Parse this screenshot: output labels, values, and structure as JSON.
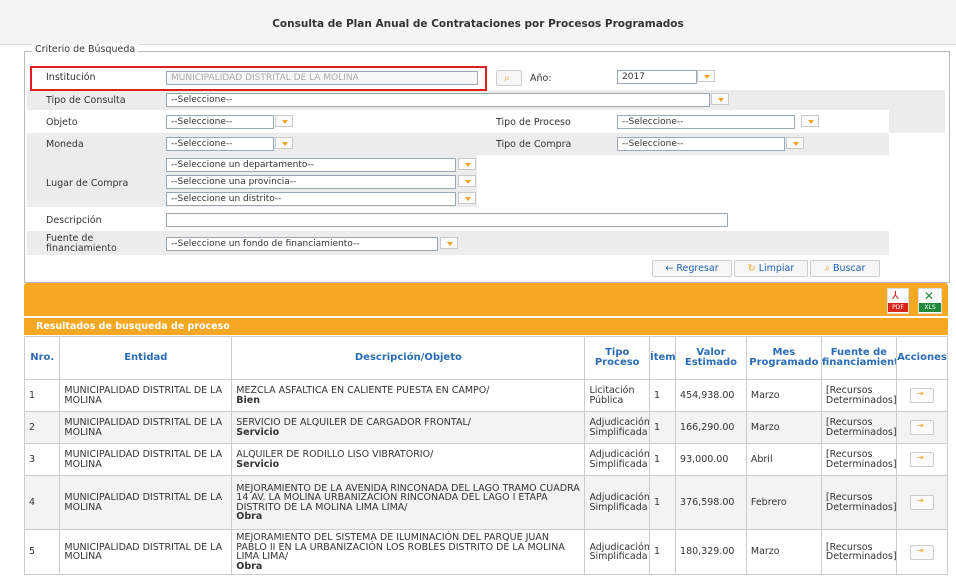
{
  "page_title": "Consulta de Plan Anual de Contrataciones por Procesos Programados",
  "criteria": {
    "legend": "Criterio de Búsqueda",
    "institucion_label": "Institución",
    "institucion_value": "MUNICIPALIDAD DISTRITAL DE LA MOLINA",
    "anio_label": "Año:",
    "anio_value": "2017",
    "tipo_consulta_label": "Tipo de Consulta",
    "tipo_consulta_value": "--Seleccione--",
    "objeto_label": "Objeto",
    "objeto_value": "--Seleccione--",
    "tipo_proceso_label": "Tipo de Proceso",
    "tipo_proceso_value": "--Seleccione--",
    "moneda_label": "Moneda",
    "moneda_value": "--Seleccione--",
    "tipo_compra_label": "Tipo de Compra",
    "tipo_compra_value": "--Seleccione--",
    "lugar_label": "Lugar de Compra",
    "departamento_value": "--Seleccione un departamento--",
    "provincia_value": "--Seleccione una provincia--",
    "distrito_value": "--Seleccione un distrito--",
    "descripcion_label": "Descripción",
    "descripcion_value": "",
    "fuente_label": "Fuente de financiamiento",
    "fuente_value": "--Seleccione un fondo de financiamiento--"
  },
  "buttons": {
    "regresar": "Regresar",
    "limpiar": "Limpiar",
    "buscar": "Buscar",
    "pdf": "PDF",
    "xls": "XLS"
  },
  "results": {
    "header": "Resultados de busqueda de proceso",
    "columns": [
      "Nro.",
      "Entidad",
      "Descripción/Objeto",
      "Tipo Proceso",
      "Ítems",
      "Valor Estimado",
      "Mes Programado",
      "Fuente de financiamiento",
      "Acciones"
    ],
    "rows": [
      {
        "nro": "1",
        "entidad": "MUNICIPALIDAD DISTRITAL DE LA MOLINA",
        "descripcion": "MEZCLA ASFALTICA EN CALIENTE PUESTA EN CAMPO/",
        "objeto": "Bien",
        "tipo": "Licitación Pública",
        "items": "1",
        "valor": "454,938.00",
        "mes": "Marzo",
        "fuente": "[Recursos Determinados]"
      },
      {
        "nro": "2",
        "entidad": "MUNICIPALIDAD DISTRITAL DE LA MOLINA",
        "descripcion": "SERVICIO DE ALQUILER DE CARGADOR FRONTAL/",
        "objeto": "Servicio",
        "tipo": "Adjudicación Simplificada",
        "items": "1",
        "valor": "166,290.00",
        "mes": "Marzo",
        "fuente": "[Recursos Determinados]"
      },
      {
        "nro": "3",
        "entidad": "MUNICIPALIDAD DISTRITAL DE LA MOLINA",
        "descripcion": "ALQUILER DE RODILLO LISO VIBRATORIO/",
        "objeto": "Servicio",
        "tipo": "Adjudicación Simplificada",
        "items": "1",
        "valor": "93,000.00",
        "mes": "Abril",
        "fuente": "[Recursos Determinados]"
      },
      {
        "nro": "4",
        "entidad": "MUNICIPALIDAD DISTRITAL DE LA MOLINA",
        "descripcion": "MEJORAMIENTO DE LA AVENIDA RINCONADA DEL LAGO TRAMO CUADRA 14 AV. LA MOLINA URBANIZACIÓN RINCONADA DEL LAGO I ETAPA DISTRITO DE LA MOLINA LIMA LIMA/",
        "objeto": "Obra",
        "tipo": "Adjudicación Simplificada",
        "items": "1",
        "valor": "376,598.00",
        "mes": "Febrero",
        "fuente": "[Recursos Determinados]"
      },
      {
        "nro": "5",
        "entidad": "MUNICIPALIDAD DISTRITAL DE LA MOLINA",
        "descripcion": "MEJORAMIENTO DEL SISTEMA DE ILUMINACIÓN DEL PARQUE JUAN PABLO II EN LA URBANIZACIÓN LOS ROBLES DISTRITO DE LA MOLINA LIMA LIMA/",
        "objeto": "Obra",
        "tipo": "Adjudicación Simplificada",
        "items": "1",
        "valor": "180,329.00",
        "mes": "Marzo",
        "fuente": "[Recursos Determinados]"
      }
    ]
  },
  "colors": {
    "accent": "#f7a823",
    "link": "#2a6db5",
    "highlight": "#e02020"
  }
}
